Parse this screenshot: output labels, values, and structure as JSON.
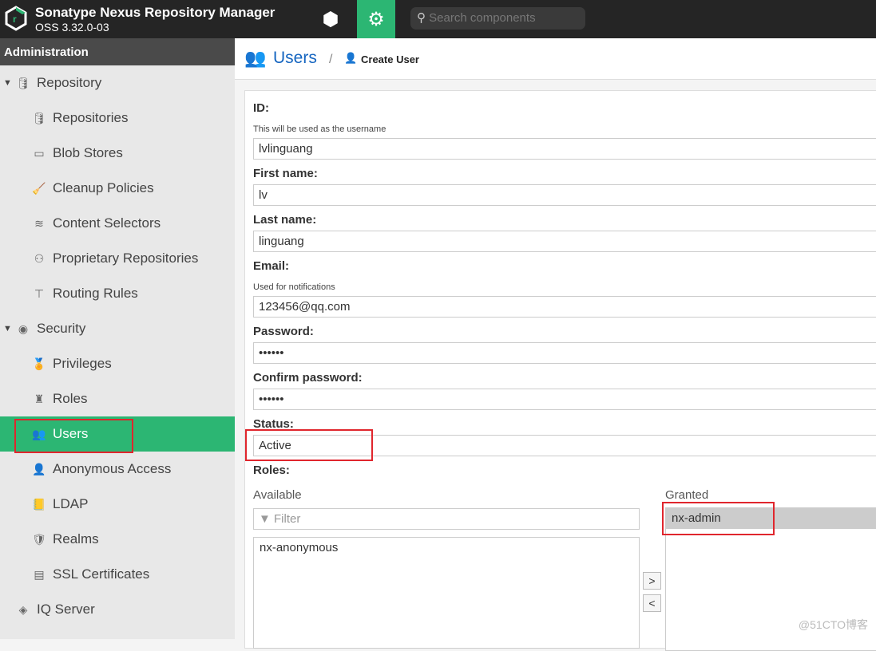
{
  "header": {
    "title": "Sonatype Nexus Repository Manager",
    "version": "OSS 3.32.0-03",
    "search_placeholder": "Search components",
    "browse_icon": "cube-icon",
    "admin_icon": "gear-icon",
    "accent": "#2cb673"
  },
  "sidebar": {
    "heading": "Administration",
    "items": [
      {
        "label": "Repository",
        "icon": "database-icon",
        "level": 0,
        "expanded": true
      },
      {
        "label": "Repositories",
        "icon": "database-icon",
        "level": 1
      },
      {
        "label": "Blob Stores",
        "icon": "drive-icon",
        "level": 1
      },
      {
        "label": "Cleanup Policies",
        "icon": "broom-icon",
        "level": 1
      },
      {
        "label": "Content Selectors",
        "icon": "layers-icon",
        "level": 1
      },
      {
        "label": "Proprietary Repositories",
        "icon": "proprietary-icon",
        "level": 1
      },
      {
        "label": "Routing Rules",
        "icon": "signpost-icon",
        "level": 1
      },
      {
        "label": "Security",
        "icon": "security-icon",
        "level": 0,
        "expanded": true
      },
      {
        "label": "Privileges",
        "icon": "medal-icon",
        "level": 1
      },
      {
        "label": "Roles",
        "icon": "role-icon",
        "level": 1
      },
      {
        "label": "Users",
        "icon": "users-icon",
        "level": 1,
        "selected": true
      },
      {
        "label": "Anonymous Access",
        "icon": "user-icon",
        "level": 1
      },
      {
        "label": "LDAP",
        "icon": "book-icon",
        "level": 1
      },
      {
        "label": "Realms",
        "icon": "shield-icon",
        "level": 1
      },
      {
        "label": "SSL Certificates",
        "icon": "certificate-icon",
        "level": 1
      },
      {
        "label": "IQ Server",
        "icon": "iq-icon",
        "level": 0
      }
    ]
  },
  "breadcrumb": {
    "section": "Users",
    "separator": "/",
    "page": "Create User"
  },
  "form": {
    "id_label": "ID:",
    "id_help": "This will be used as the username",
    "id_value": "lvlinguang",
    "first_label": "First name:",
    "first_value": "lv",
    "last_label": "Last name:",
    "last_value": "linguang",
    "email_label": "Email:",
    "email_help": "Used for notifications",
    "email_value": "123456@qq.com",
    "password_label": "Password:",
    "password_value": "••••••",
    "confirm_label": "Confirm password:",
    "confirm_value": "••••••",
    "status_label": "Status:",
    "status_value": "Active",
    "roles_label": "Roles:",
    "available_label": "Available",
    "filter_placeholder": "Filter",
    "available": [
      "nx-anonymous"
    ],
    "granted_label": "Granted",
    "granted": [
      "nx-admin"
    ],
    "add_symbol": ">",
    "remove_symbol": "<"
  },
  "watermark": "@51CTO博客"
}
